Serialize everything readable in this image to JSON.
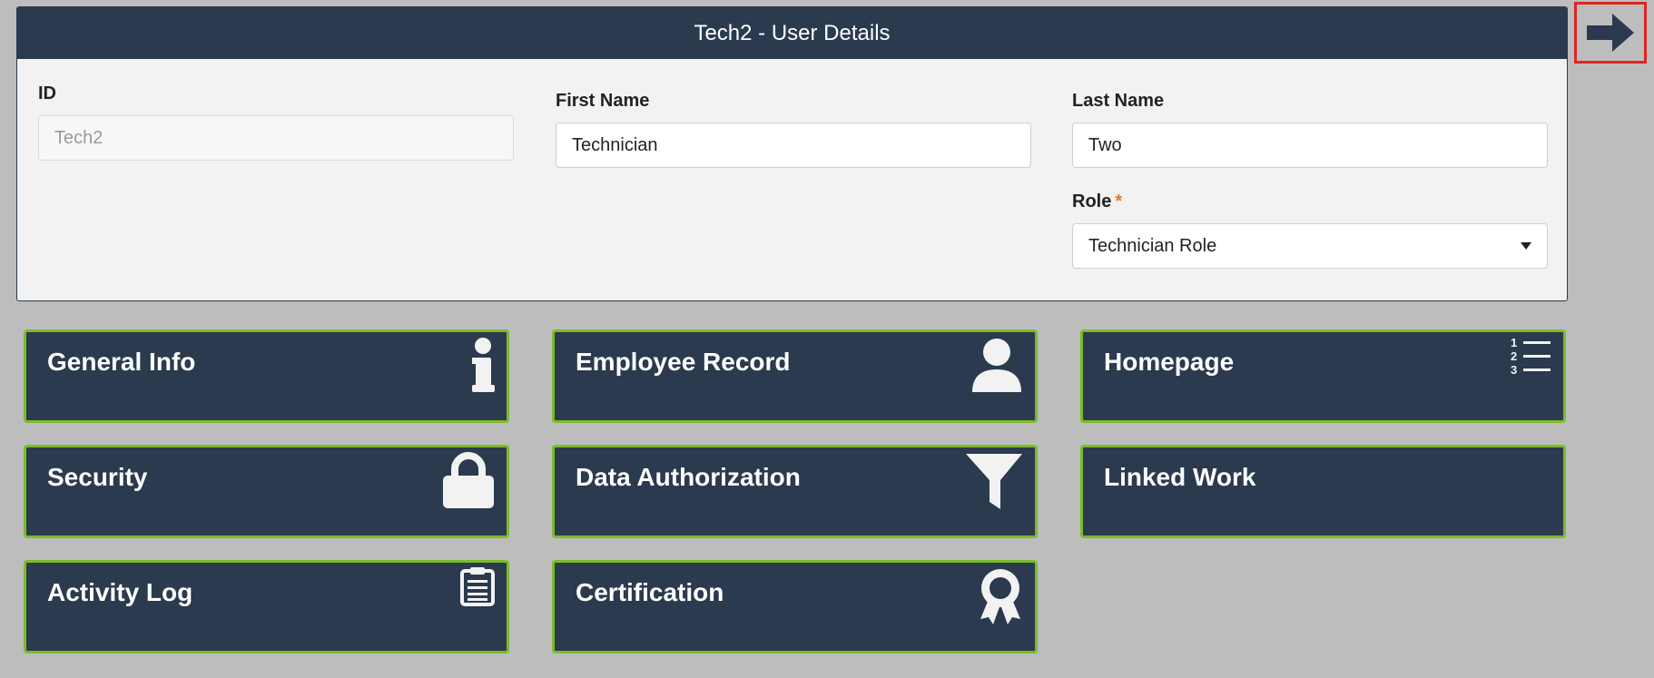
{
  "panel": {
    "title": "Tech2 - User Details"
  },
  "fields": {
    "id": {
      "label": "ID",
      "value": "Tech2"
    },
    "first_name": {
      "label": "First Name",
      "value": "Technician"
    },
    "last_name": {
      "label": "Last Name",
      "value": "Two"
    },
    "role": {
      "label": "Role",
      "required_mark": "*",
      "value": "Technician Role"
    }
  },
  "tiles": {
    "general_info": {
      "label": "General Info",
      "icon": "info-icon"
    },
    "employee_record": {
      "label": "Employee Record",
      "icon": "user-icon"
    },
    "homepage": {
      "label": "Homepage",
      "icon": "numbered-list-icon",
      "icon_numbers": [
        "1",
        "2",
        "3"
      ]
    },
    "security": {
      "label": "Security",
      "icon": "lock-icon"
    },
    "data_authorization": {
      "label": "Data Authorization",
      "icon": "filter-icon"
    },
    "linked_work": {
      "label": "Linked Work"
    },
    "activity_log": {
      "label": "Activity Log",
      "icon": "clipboard-icon"
    },
    "certification": {
      "label": "Certification",
      "icon": "award-icon"
    }
  },
  "exit_button": {
    "icon": "arrow-right-icon"
  },
  "colors": {
    "header": "#2b3a4e",
    "tile_border": "#7bbb2a",
    "exit_highlight": "#e02424",
    "background": "#bdbdbd",
    "required": "#e8731c"
  }
}
